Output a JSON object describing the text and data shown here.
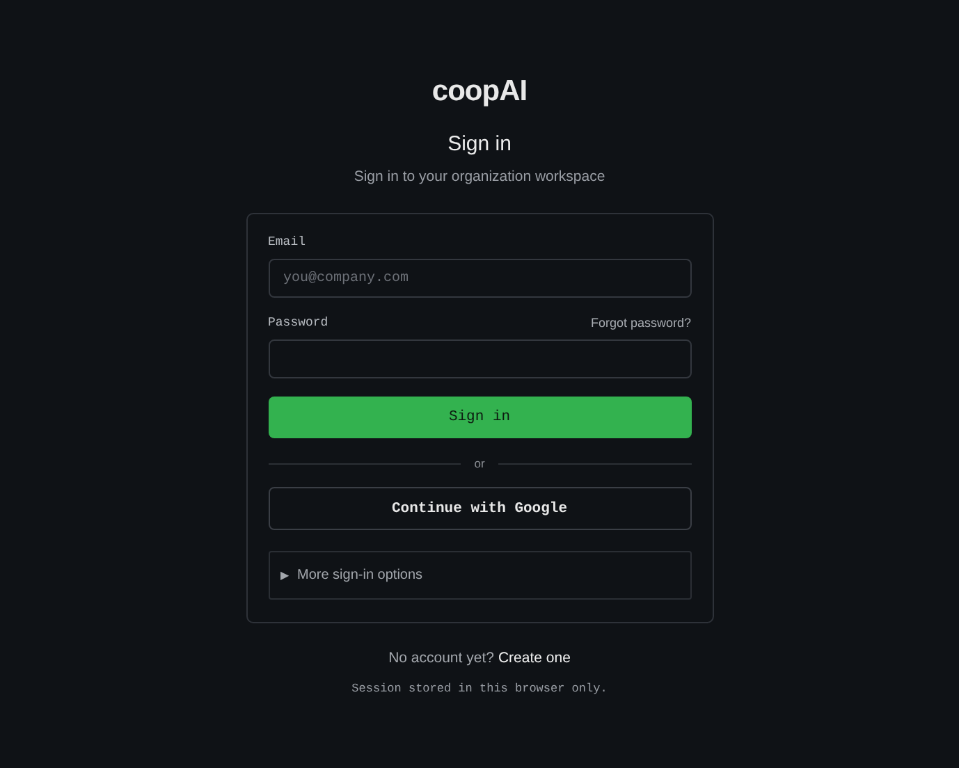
{
  "logo": "coopAI",
  "title": "Sign in",
  "subtitle": "Sign in to your organization workspace",
  "form": {
    "email": {
      "label": "Email",
      "placeholder": "you@company.com"
    },
    "password": {
      "label": "Password",
      "forgot_link": "Forgot password?"
    },
    "submit": "Sign in",
    "divider": "or",
    "google_button": "Continue with Google",
    "more_options": {
      "marker": "▶",
      "label": "More sign-in options",
      "expanded": false
    }
  },
  "footer": {
    "prompt": "No account yet?",
    "link": "Create one"
  },
  "note": "Session stored in this browser only."
}
